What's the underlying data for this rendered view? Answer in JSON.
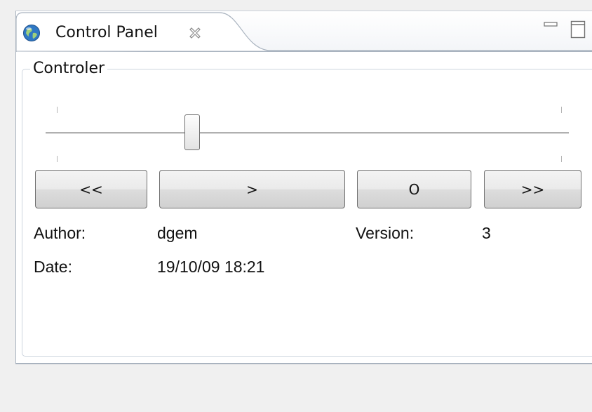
{
  "view": {
    "title": "Control Panel",
    "icon": "globe-icon",
    "close_icon": "close-icon",
    "minimize_icon": "minimize-icon",
    "maximize_icon": "maximize-icon"
  },
  "controller": {
    "group_label": "Controler",
    "slider": {
      "value_fraction": 0.28
    },
    "buttons": {
      "prev_label": "<<",
      "play_label": ">",
      "stop_label": "O",
      "next_label": ">>"
    }
  },
  "info": {
    "author_label": "Author:",
    "author_value": "dgem",
    "version_label": "Version:",
    "version_value": "3",
    "date_label": "Date:",
    "date_value": "19/10/09 18:21"
  }
}
